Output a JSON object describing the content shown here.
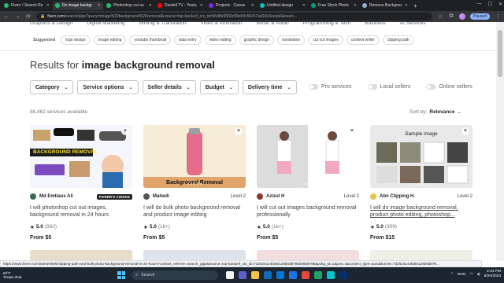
{
  "browser": {
    "tabs": [
      {
        "title": "Fiverr / Search Re",
        "color": "#1dbf73",
        "active": false
      },
      {
        "title": "Do image backgr",
        "color": "#1dbf73",
        "active": true
      },
      {
        "title": "Photoshop cut ou",
        "color": "#1dbf73",
        "active": false
      },
      {
        "title": "Durdell TV - Youtu",
        "color": "#ff0000",
        "active": false
      },
      {
        "title": "Projects - Canva",
        "color": "#7d2ae8",
        "active": false
      },
      {
        "title": "Untitled design",
        "color": "#00c4cc",
        "active": false
      },
      {
        "title": "Free Stock Photo",
        "color": "#05a081",
        "active": false
      },
      {
        "title": "Remove Backgrou",
        "color": "#8fb3d9",
        "active": false
      }
    ],
    "url_host": "fiverr.com",
    "url_path": "/search/gigs?query=image%20background%20removal&source=top-bar&ref_ctx_id=b5d8e9569c89e64c56d17ad18c6eeda5&searc...",
    "paused_label": "Paused",
    "status_url": "https://www.fiverr.com/animesh96/clipping-path-and-bulk-photo-background-removal-in-24-hours?context_referrer=search_gigs&source=top-bar&ref_ctx_id=732624144fa50126b6d879825658788&pckg_id=1&pos=4&context_type=auto&funnel=732624144fa50126b6d879..."
  },
  "catnav": [
    "Graphics & Design",
    "Digital Marketing",
    "Writing & Translation",
    "Video & Animation",
    "Music & Audio",
    "Programming & Tech",
    "Business",
    "AI Services"
  ],
  "suggested": {
    "label": "Suggested",
    "chips": [
      "logo design",
      "image editing",
      "youtube thumbnail",
      "data entry",
      "video editing",
      "graphic design",
      "translation",
      "cut out images",
      "content writer",
      "clipping path"
    ]
  },
  "results": {
    "prefix": "Results for ",
    "query": "image background removal"
  },
  "filters": [
    "Category",
    "Service options",
    "Seller details",
    "Budget",
    "Delivery time"
  ],
  "toggles": [
    "Pro services",
    "Local sellers",
    "Online sellers"
  ],
  "count": "88,462 services available",
  "sort": {
    "label": "Sort by:",
    "value": "Relevance"
  },
  "gigs": [
    {
      "seller": "Md Emtiaus Ali",
      "level": "",
      "badge": "FIVERR'S CHOICE",
      "title": "I will photoshop cut out images, background removal in 24 hours",
      "rating": "5.0",
      "reviews": "(960)",
      "price": "From $5",
      "thumb_caption": "BACKGROUND REMOVAL",
      "avatar_color": "#3d6b4f",
      "underline": false
    },
    {
      "seller": "Mahedi",
      "level": "Level 2",
      "badge": "",
      "title": "I will do bulk photo background removal and product image editing",
      "rating": "5.0",
      "reviews": "(1k+)",
      "price": "From $5",
      "thumb_caption": "Background Removal",
      "avatar_color": "#555",
      "underline": false
    },
    {
      "seller": "Azizul H",
      "level": "Level 2",
      "badge": "",
      "title": "I will cut out images background removal professionally",
      "rating": "5.0",
      "reviews": "(1k+)",
      "price": "From $5",
      "thumb_caption": "",
      "avatar_color": "#8a3b2c",
      "underline": false
    },
    {
      "seller": "Abn Clipping H.",
      "level": "Level 2",
      "badge": "",
      "title": "I will do image background removal, product photo editing, photoshop...",
      "rating": "5.0",
      "reviews": "(309)",
      "price": "From $15",
      "thumb_caption": "Sample image",
      "avatar_color": "#e0c64a",
      "underline": true
    }
  ],
  "taskbar": {
    "temp": "62°F",
    "weather": "Temps drop",
    "search": "Search",
    "lang": "ENG",
    "time": "2:44 PM",
    "date": "6/20/2023"
  }
}
